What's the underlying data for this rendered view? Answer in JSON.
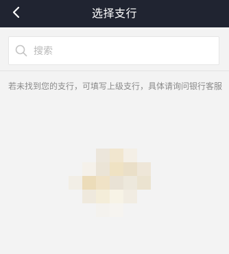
{
  "nav": {
    "title": "选择支行",
    "back_icon": "chevron-left-icon",
    "background": "#202431"
  },
  "search": {
    "placeholder": "搜索",
    "value": "",
    "icon": "search-icon"
  },
  "hint": {
    "text": "若未找到您的支行，可填写上级支行，具体请询问银行客服"
  },
  "colors": {
    "page_background": "#f3f3f3",
    "nav_text": "#ffffff",
    "hint_text": "#8a8a8a"
  }
}
